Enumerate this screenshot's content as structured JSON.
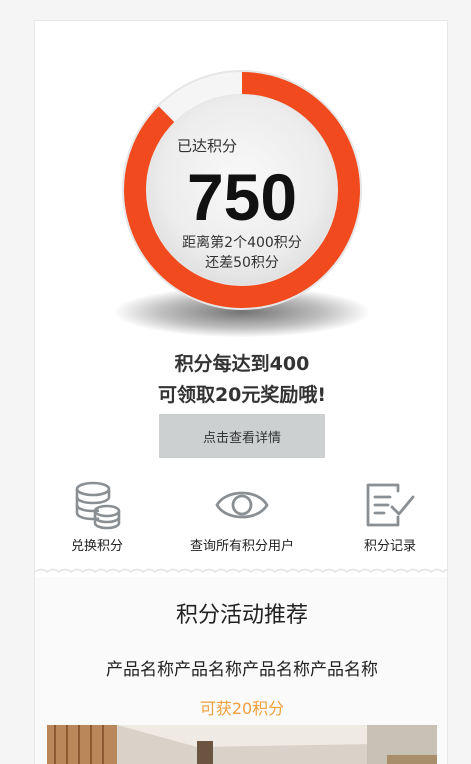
{
  "points": {
    "label": "已达积分",
    "value": "750",
    "progress_fraction": 0.875,
    "distance_line1": "距离第2个400积分",
    "distance_line2": "还差50积分"
  },
  "promo": {
    "line1": "积分每达到400",
    "line2": "可领取20元奖励哦!"
  },
  "detail_button": "点击查看详情",
  "features": [
    {
      "label": "兑换积分",
      "icon": "coins-stack-icon"
    },
    {
      "label": "查询所有积分用户",
      "icon": "eye-icon"
    },
    {
      "label": "积分记录",
      "icon": "record-check-icon"
    }
  ],
  "activity": {
    "title": "积分活动推荐",
    "product_name": "产品名称产品名称产品名称产品名称",
    "points_text": "可获20积分"
  },
  "colors": {
    "accent": "#f04a1e",
    "ring_track": "#f3f3f3",
    "button_bg": "#ccd0d1",
    "points_orange": "#f0a03c"
  }
}
